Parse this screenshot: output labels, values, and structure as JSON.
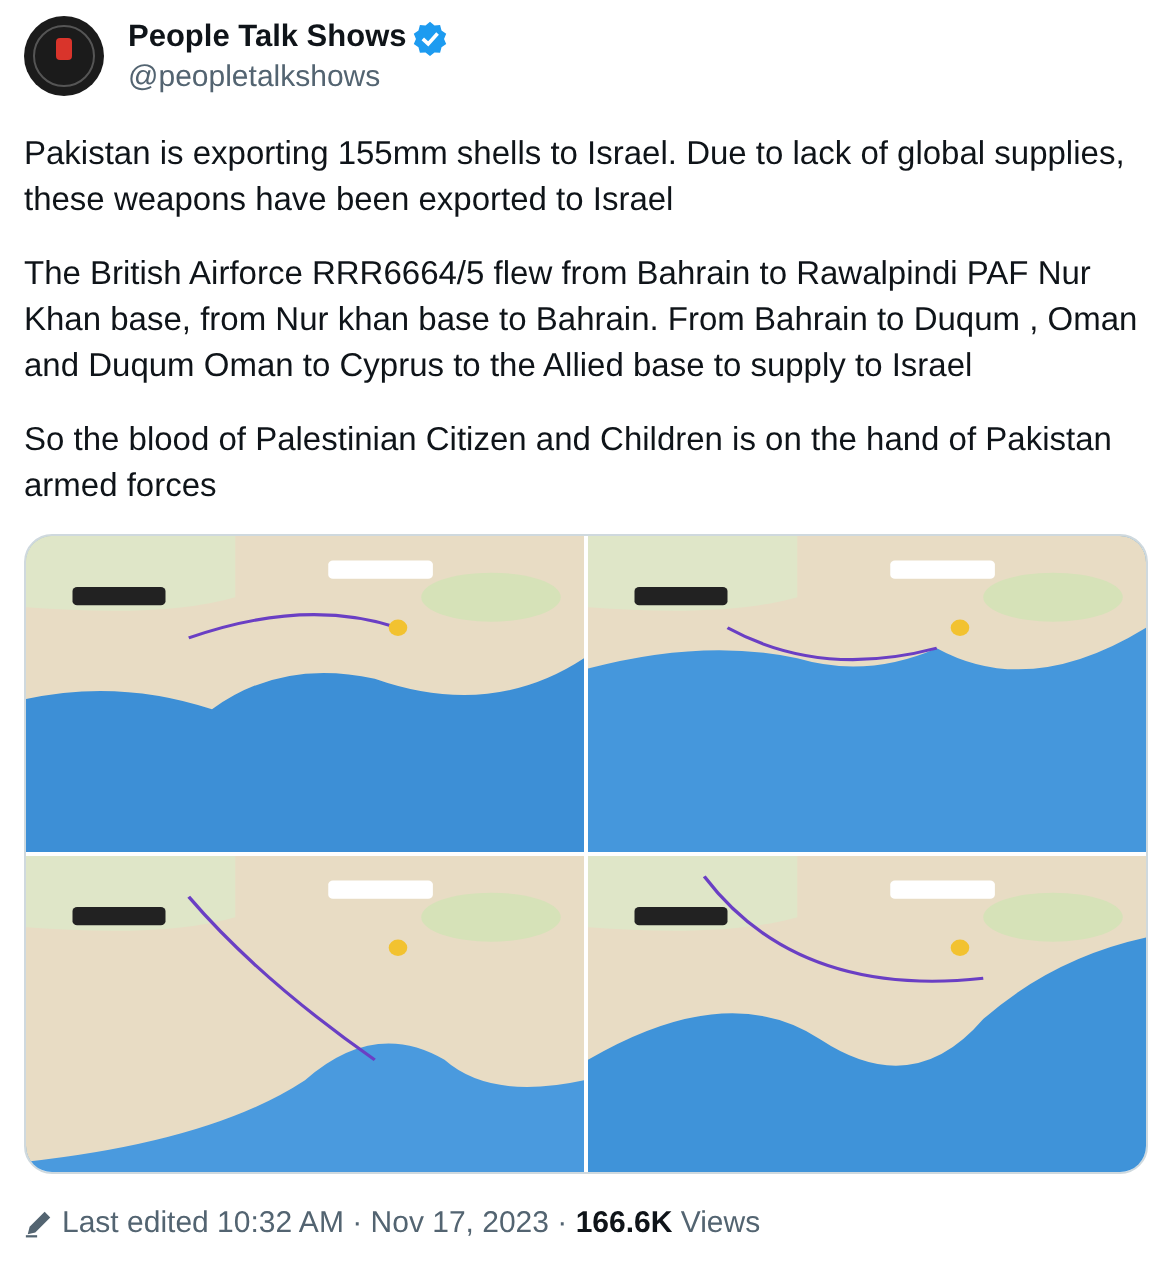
{
  "author": {
    "name": "People Talk Shows",
    "handle": "@peopletalkshows",
    "verified": true
  },
  "paragraphs": [
    "Pakistan is exporting 155mm shells to Israel. Due to lack of global supplies, these weapons have been exported to Israel",
    "The British Airforce RRR6664/5 flew from Bahrain to Rawalpindi PAF Nur Khan base, from Nur khan base to Bahrain. From Bahrain to Duqum , Oman and Duqum Oman to Cyprus to the Allied base to supply to Israel",
    "So the blood of Palestinian Citizen and Children is on the hand of Pakistan armed forces"
  ],
  "media": [
    {
      "kind": "picture"
    },
    {
      "kind": "picture"
    },
    {
      "kind": "picture"
    },
    {
      "kind": "picture"
    }
  ],
  "footer": {
    "edited": true,
    "text": "Last edited 10:32 AM · Nov 17, 2023 · **166.6K** Views"
  }
}
